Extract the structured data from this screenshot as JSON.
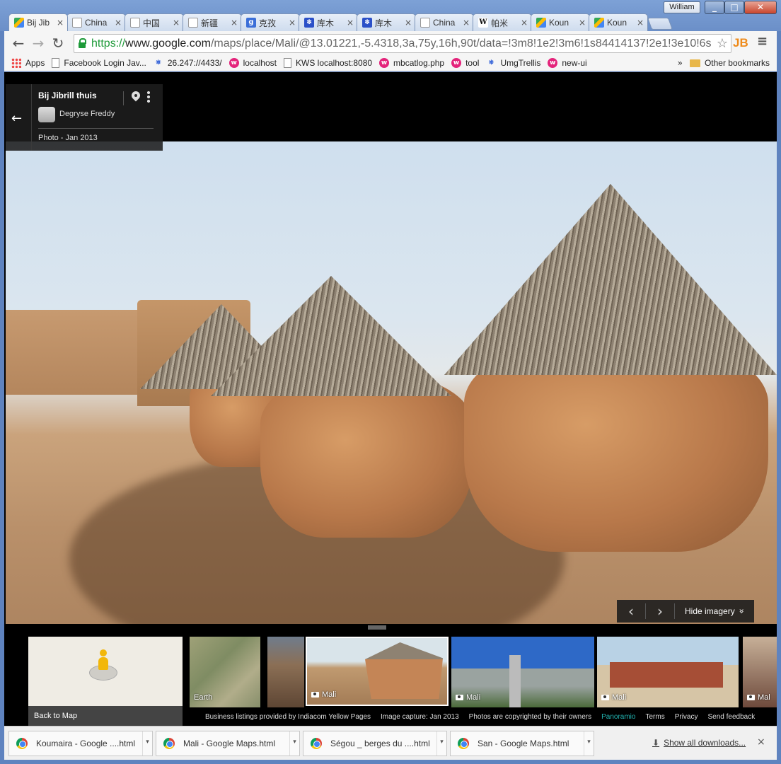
{
  "window": {
    "user": "William",
    "minimize_icon": "minimize-icon",
    "maximize_icon": "maximize-icon",
    "close_icon": "close-icon"
  },
  "tabs": [
    {
      "title": "Bij Jib",
      "favicon": "maps",
      "active": true
    },
    {
      "title": "China",
      "favicon": "doc"
    },
    {
      "title": "中国",
      "favicon": "doc"
    },
    {
      "title": "新疆",
      "favicon": "doc"
    },
    {
      "title": "克孜",
      "favicon": "g"
    },
    {
      "title": "库木",
      "favicon": "paw"
    },
    {
      "title": "库木",
      "favicon": "paw"
    },
    {
      "title": "China",
      "favicon": "doc"
    },
    {
      "title": "帕米",
      "favicon": "w"
    },
    {
      "title": "Koun",
      "favicon": "maps"
    },
    {
      "title": "Koun",
      "favicon": "maps"
    }
  ],
  "toolbar": {
    "back": "←",
    "forward": "→",
    "reload": "↻",
    "url_scheme": "https://",
    "url_host": "www.google.com",
    "url_path": "/maps/place/Mali/@13.01221,-5.4318,3a,75y,16h,90t/data=!3m8!1e2!3m6!1s84414137!2e1!3e10!6s",
    "star": "☆",
    "extension": "JB",
    "menu": "≡"
  },
  "bookmarks": [
    {
      "label": "Apps",
      "icon": "apps"
    },
    {
      "label": "Facebook Login Jav...",
      "icon": "doc"
    },
    {
      "label": "26.247://4433/",
      "icon": "sat"
    },
    {
      "label": "localhost",
      "icon": "w"
    },
    {
      "label": "KWS localhost:8080",
      "icon": "doc"
    },
    {
      "label": "mbcatlog.php",
      "icon": "w"
    },
    {
      "label": "tool",
      "icon": "w"
    },
    {
      "label": "UmgTrellis",
      "icon": "sat"
    },
    {
      "label": "new-ui",
      "icon": "w"
    }
  ],
  "bookmarks_more": "»",
  "other_bookmarks": "Other bookmarks",
  "info_card": {
    "title": "Bij Jibrill thuis",
    "author": "Degryse Freddy",
    "date": "Photo - Jan 2013",
    "back": "←"
  },
  "zoom": {
    "plus": "+",
    "minus": "−"
  },
  "image_nav": {
    "prev": "‹",
    "next": "›",
    "hide": "Hide imagery",
    "hide_icon": "»"
  },
  "filmstrip": {
    "back_to_map": "Back to Map",
    "thumbs": [
      {
        "label": "Earth",
        "camera": false
      },
      {
        "label": "",
        "camera": false
      },
      {
        "label": "Mali",
        "camera": true,
        "selected": true
      },
      {
        "label": "Mali",
        "camera": true
      },
      {
        "label": "Mali",
        "camera": true
      },
      {
        "label": "Mal",
        "camera": true
      }
    ]
  },
  "footer": {
    "listings": "Business listings provided by Indiacom Yellow Pages",
    "capture": "Image capture: Jan 2013",
    "copyright": "Photos are copyrighted by their owners",
    "panoramio": "Panoramio",
    "terms": "Terms",
    "privacy": "Privacy",
    "feedback": "Send feedback"
  },
  "downloads": {
    "items": [
      {
        "name": "Koumaira - Google ....html"
      },
      {
        "name": "Mali - Google Maps.html"
      },
      {
        "name": "Ségou _ berges du ....html"
      },
      {
        "name": "San - Google Maps.html"
      }
    ],
    "show_all": "Show all downloads...",
    "close": "×"
  }
}
